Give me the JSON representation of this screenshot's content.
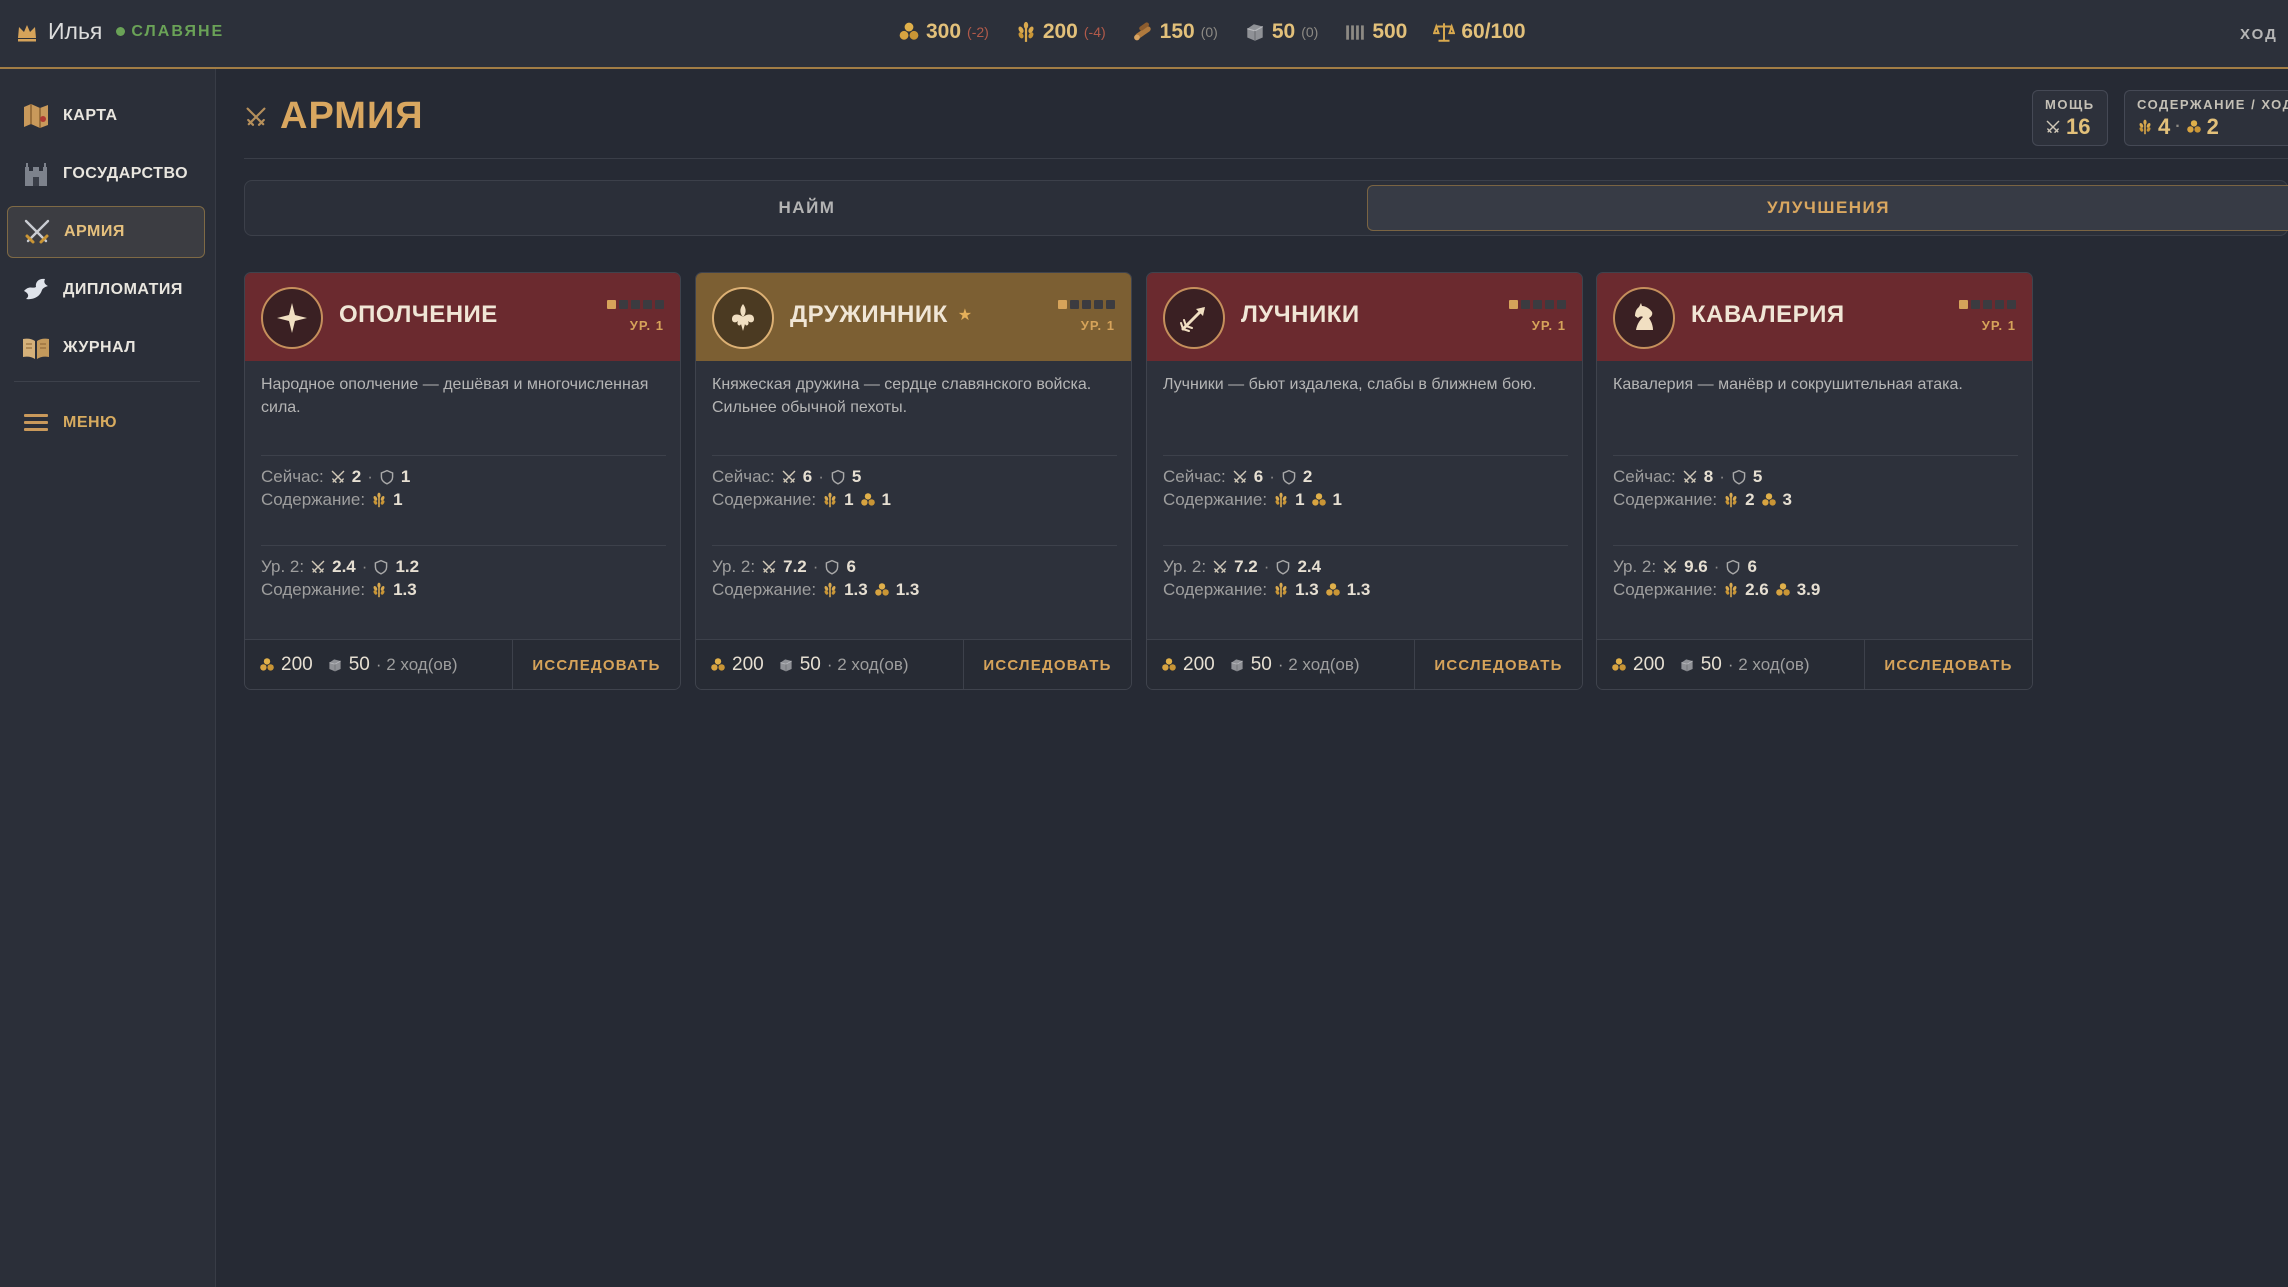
{
  "topbar": {
    "player_name": "Илья",
    "faction": "СЛАВЯНЕ",
    "resources": [
      {
        "icon": "gold-icon",
        "value": "300",
        "delta": "(-2)"
      },
      {
        "icon": "grain-icon",
        "value": "200",
        "delta": "(-4)"
      },
      {
        "icon": "wood-icon",
        "value": "150",
        "delta": "(0)"
      },
      {
        "icon": "stone-icon",
        "value": "50",
        "delta": "(0)"
      },
      {
        "icon": "population-icon",
        "value": "500",
        "delta": ""
      },
      {
        "icon": "balance-icon",
        "value": "60/100",
        "delta": ""
      }
    ],
    "turn_label": "ХОД"
  },
  "sidebar": {
    "items": [
      {
        "label": "КАРТА",
        "icon": "map-icon"
      },
      {
        "label": "ГОСУДАРСТВО",
        "icon": "castle-icon"
      },
      {
        "label": "АРМИЯ",
        "icon": "swords-icon"
      },
      {
        "label": "ДИПЛОМАТИЯ",
        "icon": "dove-icon"
      },
      {
        "label": "ЖУРНАЛ",
        "icon": "book-icon"
      }
    ],
    "menu_label": "МЕНЮ"
  },
  "page": {
    "title": "АРМИЯ",
    "power": {
      "label": "МОЩЬ",
      "value": "16"
    },
    "upkeep": {
      "label": "СОДЕРЖАНИЕ / ХОД",
      "grain": "4",
      "gold": "2"
    }
  },
  "tabs": [
    {
      "label": "НАЙМ",
      "active": false
    },
    {
      "label": "УЛУЧШЕНИЯ",
      "active": true
    }
  ],
  "cards": [
    {
      "title": "ОПОЛЧЕНИЕ",
      "level": "УР. 1",
      "desc": "Народное ополчение — дешёвая и многочисленная сила.",
      "now_label": "Сейчас:",
      "now_atk": "2",
      "now_def": "1",
      "upkeep_label": "Содержание:",
      "now_grain": "1",
      "now_gold": "",
      "next_label": "Ур. 2:",
      "next_atk": "2.4",
      "next_def": "1.2",
      "next_grain": "1.3",
      "next_gold": "",
      "cost_gold": "200",
      "cost_stone": "50",
      "turns": "· 2 ход(ов)",
      "button": "ИССЛЕДОВАТЬ"
    },
    {
      "title": "ДРУЖИННИК",
      "level": "УР. 1",
      "desc": "Княжеская дружина — сердце славянского войска. Сильнее обычной пехоты.",
      "now_label": "Сейчас:",
      "now_atk": "6",
      "now_def": "5",
      "upkeep_label": "Содержание:",
      "now_grain": "1",
      "now_gold": "1",
      "next_label": "Ур. 2:",
      "next_atk": "7.2",
      "next_def": "6",
      "next_grain": "1.3",
      "next_gold": "1.3",
      "cost_gold": "200",
      "cost_stone": "50",
      "turns": "· 2 ход(ов)",
      "button": "ИССЛЕДОВАТЬ"
    },
    {
      "title": "ЛУЧНИКИ",
      "level": "УР. 1",
      "desc": "Лучники — бьют издалека, слабы в ближнем бою.",
      "now_label": "Сейчас:",
      "now_atk": "6",
      "now_def": "2",
      "upkeep_label": "Содержание:",
      "now_grain": "1",
      "now_gold": "1",
      "next_label": "Ур. 2:",
      "next_atk": "7.2",
      "next_def": "2.4",
      "next_grain": "1.3",
      "next_gold": "1.3",
      "cost_gold": "200",
      "cost_stone": "50",
      "turns": "· 2 ход(ов)",
      "button": "ИССЛЕДОВАТЬ"
    },
    {
      "title": "КАВАЛЕРИЯ",
      "level": "УР. 1",
      "desc": "Кавалерия — манёвр и сокрушительная атака.",
      "now_label": "Сейчас:",
      "now_atk": "8",
      "now_def": "5",
      "upkeep_label": "Содержание:",
      "now_grain": "2",
      "now_gold": "3",
      "next_label": "Ур. 2:",
      "next_atk": "9.6",
      "next_def": "6",
      "next_grain": "2.6",
      "next_gold": "3.9",
      "cost_gold": "200",
      "cost_stone": "50",
      "turns": "· 2 ход(ов)",
      "button": "ИССЛЕДОВАТЬ"
    }
  ]
}
